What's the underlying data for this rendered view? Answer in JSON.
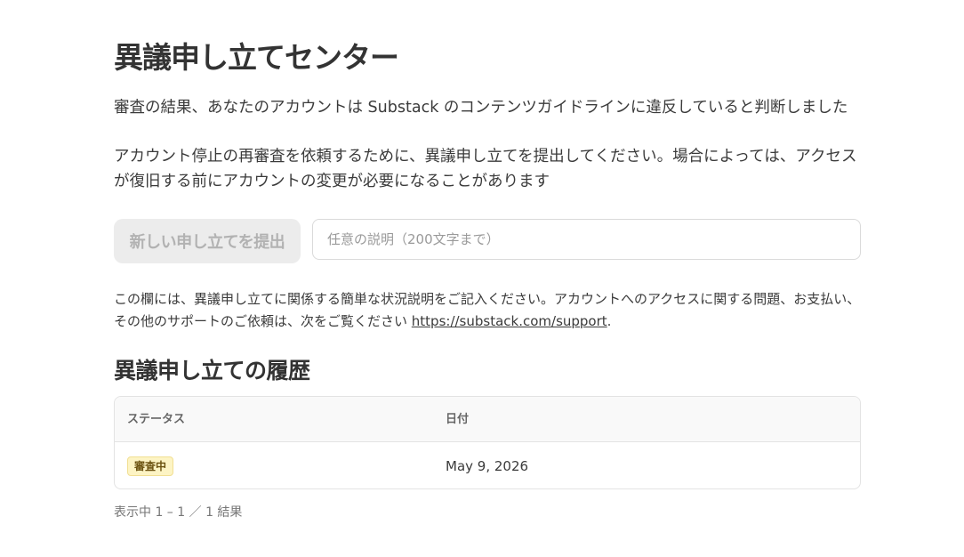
{
  "page": {
    "title": "異議申し立てセンター",
    "intro_line1": "審査の結果、あなたのアカウントは Substack のコンテンツガイドラインに違反していると判断しました",
    "intro_line2": "アカウント停止の再審査を依頼するために、異議申し立てを提出してください。場合によっては、アクセスが復旧する前にアカウントの変更が必要になることがあります"
  },
  "form": {
    "submit_label": "新しい申し立てを提出",
    "submit_enabled": false,
    "description_placeholder": "任意の説明（200文字まで）",
    "description_value": ""
  },
  "help": {
    "text": "この欄には、異議申し立てに関係する簡単な状況説明をご記入ください。アカウントへのアクセスに関する問題、お支払い、その他のサポートのご依頼は、次をご覧ください ",
    "link_text": "https://substack.com/support",
    "trailing": "."
  },
  "history": {
    "title": "異議申し立ての履歴",
    "columns": {
      "status": "ステータス",
      "date": "日付"
    },
    "rows": [
      {
        "status": "審査中",
        "date": "May 9, 2026"
      }
    ],
    "result_summary": "表示中 1 – 1 ／ 1 結果"
  },
  "colors": {
    "badge_bg": "#fdf4c4",
    "badge_text": "#6b5210",
    "disabled_button_bg": "#ececec",
    "disabled_button_text": "#b2b2b2"
  }
}
